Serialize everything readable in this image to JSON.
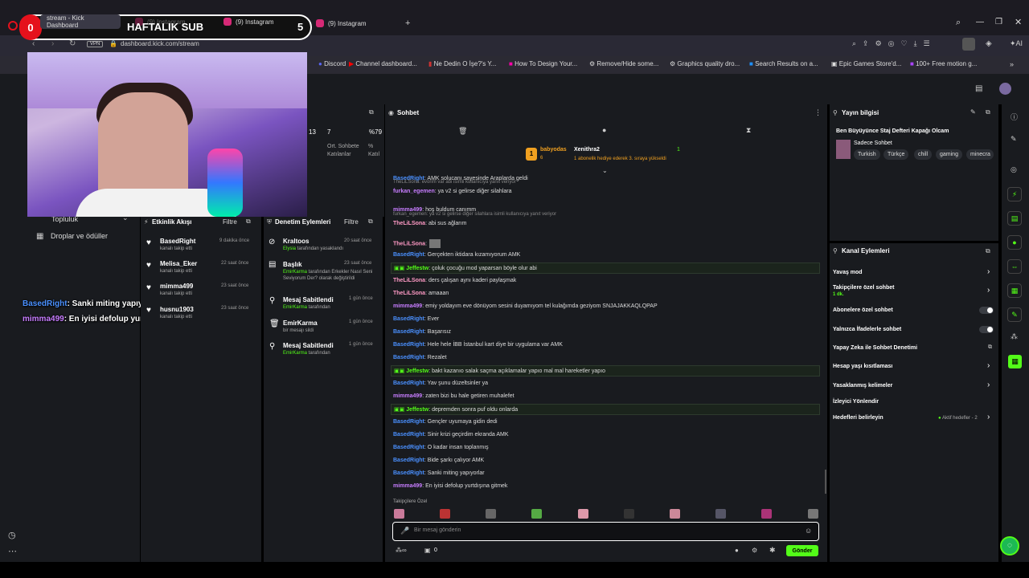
{
  "browser": {
    "tabs": [
      "stream - Kick Dashboard",
      "(9) Instagram",
      "(9) Instagram",
      "(9) Instagram"
    ],
    "url": "dashboard.kick.com/stream",
    "vpn_label": "VPN",
    "bookmarks": [
      "Discord",
      "Channel dashboard...",
      "Ne Dedin O İşe?'s Y...",
      "How To Design Your...",
      "Remove/Hide some...",
      "Graphics quality dro...",
      "Search Results on a...",
      "Epic Games Store'd...",
      "100+ Free motion g..."
    ]
  },
  "overlay": {
    "badge_left": "0",
    "badge_title": "HAFTALIK SUB",
    "badge_right": "5",
    "chat_lines": [
      {
        "user": "BasedRight",
        "text": ": Sanki miting yapıyorlar"
      },
      {
        "user": "mimma499",
        "text": ": En iyisi defolup yurtdışına gitmek"
      }
    ]
  },
  "left_nav": {
    "items": [
      "Topluluk",
      "Droplar ve ödüller"
    ]
  },
  "stats": {
    "values": [
      "13",
      "7",
      "%79"
    ],
    "labels": [
      "Ort. Sohbete Katılanlar",
      "% Katıl"
    ]
  },
  "activity": {
    "title": "Etkinlik Akışı",
    "filter": "Filtre",
    "items": [
      {
        "name": "BasedRight",
        "sub": "kanalı takip etti",
        "time": "9 dakika önce"
      },
      {
        "name": "Melisa_Eker",
        "sub": "kanalı takip etti",
        "time": "22 saat önce"
      },
      {
        "name": "mimma499",
        "sub": "kanalı takip etti",
        "time": "23 saat önce"
      },
      {
        "name": "husnu1903",
        "sub": "kanalı takip etti",
        "time": "23 saat önce"
      }
    ]
  },
  "moderation": {
    "title": "Denetim Eylemleri",
    "filter": "Filtre",
    "items": [
      {
        "title": "Kraltoos",
        "line1": "Elysia",
        "line1_rest": " tarafından yasaklandı",
        "time": "20 saat önce"
      },
      {
        "title": "Başlık",
        "line1": "EmirKarma",
        "line1_rest": " tarafından Erkekler Nasıl Seni Seviyorum Der? olarak değiştirildi",
        "time": "23 saat önce"
      },
      {
        "title": "Mesaj Sabitlendi",
        "line1": "EmirKarma",
        "line1_rest": " tarafından",
        "time": "1 gün önce"
      },
      {
        "title": "EmirKarma",
        "line1": "",
        "line1_rest": "bir mesajı sildi",
        "time": "1 gün önce"
      },
      {
        "title": "Mesaj Sabitlendi",
        "line1": "EmirKarma",
        "line1_rest": " tarafından",
        "time": "1 gün önce"
      }
    ]
  },
  "chat": {
    "title": "Sohbet",
    "pinned_user1": "babyodas",
    "pinned_user2": "Xenithra2",
    "pinned_count": "1",
    "pinned_rank": "6",
    "pinned_text": "1 abonelik hediye ederek 3. sıraya yükseldi",
    "messages": [
      {
        "user": "BasedRight",
        "color": "#4a90ff",
        "text": ": AMK solucanı sayesinde Araplarda geldi",
        "reply": ""
      },
      {
        "user": "furkan_egemen",
        "color": "#c77dff",
        "text": ": ya v2 si gelirse diğer silahlara",
        "reply": "TheLiLSona: evorim var abi isimli kullanıcıya yanıt veriyor"
      },
      {
        "user": "mimma499",
        "color": "#c77dff",
        "text": ": hoş buldum canımm",
        "reply": ""
      },
      {
        "user": "TheLiLSona",
        "color": "#ff9ac5",
        "text": ": abi sus ağlarım",
        "reply": "furkan_egemen: ya v2 si gelirse diğer silahlara isimli kullanıcıya yanıt veriyor"
      },
      {
        "user": "TheLiLSona",
        "color": "#ff9ac5",
        "text": ":",
        "reply": ""
      },
      {
        "user": "BasedRight",
        "color": "#4a90ff",
        "text": ": Gerçekten iktidara kızamıyorum AMK",
        "reply": ""
      },
      {
        "user": "Jeffestw",
        "color": "#53fc18",
        "text": ": çoluk çocuğu mod yaparsan böyle olur abi",
        "reply": "",
        "highlight": true
      },
      {
        "user": "TheLiLSona",
        "color": "#ff9ac5",
        "text": ": ders çalışan aynı kaderi paylaşmak",
        "reply": ""
      },
      {
        "user": "TheLiLSona",
        "color": "#ff9ac5",
        "text": ": amaaan",
        "reply": ""
      },
      {
        "user": "mimma499",
        "color": "#c77dff",
        "text": ": emiy yoldayım eve dönüyom sesini duyamıyom tel kulağımda geziyom SNJAJAKKAQLQPAP",
        "reply": ""
      },
      {
        "user": "BasedRight",
        "color": "#4a90ff",
        "text": ": Ever",
        "reply": ""
      },
      {
        "user": "BasedRight",
        "color": "#4a90ff",
        "text": ": Başarısız",
        "reply": ""
      },
      {
        "user": "BasedRight",
        "color": "#4a90ff",
        "text": ": Hele hele İBB İstanbul kart diye bir uygulama var AMK",
        "reply": ""
      },
      {
        "user": "BasedRight",
        "color": "#4a90ff",
        "text": ": Rezalet",
        "reply": ""
      },
      {
        "user": "Jeffestw",
        "color": "#53fc18",
        "text": ": bakt kazanıo salak saçma açıklamalar yapıo mal mal hareketler yapıo",
        "reply": "",
        "highlight": true
      },
      {
        "user": "BasedRight",
        "color": "#4a90ff",
        "text": ": Yav şunu düzeltsinler ya",
        "reply": ""
      },
      {
        "user": "mimma499",
        "color": "#c77dff",
        "text": ": zaten bizi bu hale getiren muhalefet",
        "reply": ""
      },
      {
        "user": "Jeffestw",
        "color": "#53fc18",
        "text": ": depremden sonra puf oldu onlarda",
        "reply": "",
        "highlight": true
      },
      {
        "user": "BasedRight",
        "color": "#4a90ff",
        "text": ": Gençler uyumaya gidin dedi",
        "reply": ""
      },
      {
        "user": "BasedRight",
        "color": "#4a90ff",
        "text": ": Sinir krizi geçirdim ekranda AMK",
        "reply": ""
      },
      {
        "user": "BasedRight",
        "color": "#4a90ff",
        "text": ": O kadar insan toplanmış",
        "reply": ""
      },
      {
        "user": "BasedRight",
        "color": "#4a90ff",
        "text": ": Bide şarkı çalıyor AMK",
        "reply": ""
      },
      {
        "user": "BasedRight",
        "color": "#4a90ff",
        "text": ": Sanki miting yapıyorlar",
        "reply": ""
      },
      {
        "user": "mimma499",
        "color": "#c77dff",
        "text": ": En iyisi defolup yurtdışına gitmek",
        "reply": ""
      }
    ],
    "emote_section": "Takipçilere Özel",
    "input_placeholder": "Bir mesaj gönderin",
    "send_label": "Gönder",
    "counter": "0"
  },
  "stream_info": {
    "title": "Yayın bilgisi",
    "stream_title": "Ben Büyüyünce Staj Defteri Kapağı Olcam",
    "category": "Sadece Sohbet",
    "tags": [
      "Turkish",
      "Türkçe",
      "chill",
      "gaming",
      "minecra"
    ]
  },
  "channel_actions": {
    "title": "Kanal Eylemleri",
    "rows": [
      {
        "label": "Yavaş mod",
        "control": "chevron"
      },
      {
        "label": "Takipçilere özel sohbet",
        "sub": "1 dk.",
        "control": "chevron"
      },
      {
        "label": "Abonelere özel sohbet",
        "control": "toggle"
      },
      {
        "label": "Yalnızca İfadelerle sohbet",
        "control": "toggle"
      },
      {
        "label": "Yapay Zeka ile Sohbet Denetimi",
        "control": "external"
      },
      {
        "label": "Hesap yaşı kısıtlaması",
        "control": "chevron"
      },
      {
        "label": "Yasaklanmış kelimeler",
        "control": "chevron"
      },
      {
        "label": "İzleyici Yönlendir",
        "control": "none"
      },
      {
        "label": "Hedefleri belirleyin",
        "control": "goals",
        "extra": "Aktif hedefler - 2"
      }
    ]
  },
  "colors": {
    "accent": "#53fc18",
    "panel": "#191b1f",
    "badge_red": "#e5111c"
  }
}
